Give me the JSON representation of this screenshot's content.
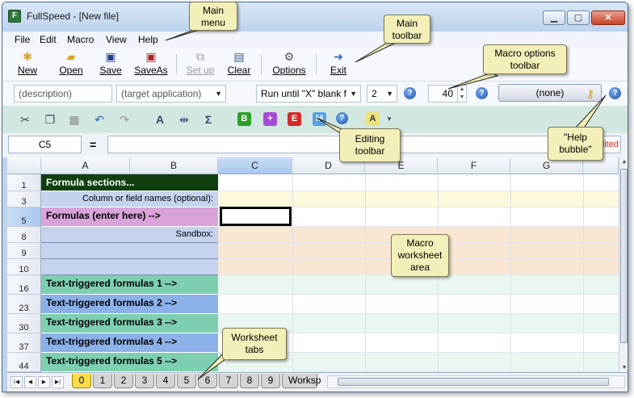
{
  "window": {
    "title": "FullSpeed - [New file]"
  },
  "menu": [
    "File",
    "Edit",
    "Macro",
    "View",
    "Help"
  ],
  "main_toolbar": [
    {
      "label": "New",
      "icon": "new-file-icon"
    },
    {
      "label": "Open",
      "icon": "open-folder-icon"
    },
    {
      "label": "Save",
      "icon": "save-disk-icon"
    },
    {
      "label": "SaveAs",
      "icon": "save-as-icon"
    },
    {
      "label": "Set up",
      "icon": "setup-icon",
      "disabled": true
    },
    {
      "label": "Clear",
      "icon": "clear-icon"
    },
    {
      "label": "Options",
      "icon": "options-icon"
    },
    {
      "label": "Exit",
      "icon": "exit-icon"
    }
  ],
  "macro_options": {
    "description_placeholder": "(description)",
    "target_app_placeholder": "(target application)",
    "run_mode": "Run until \"X\" blank f",
    "count": "2",
    "speed": "40",
    "hotkey": "(none)"
  },
  "formula_bar": {
    "cell_ref": "C5",
    "eq": "=",
    "edited_label": "dited"
  },
  "columns": [
    "A",
    "B",
    "C",
    "D",
    "E",
    "F",
    "G"
  ],
  "rows": [
    {
      "num": "1",
      "label": "Formula sections...",
      "style": "section"
    },
    {
      "num": "3",
      "label": "Column or field names  (optional):",
      "style": "names"
    },
    {
      "num": "5",
      "label": "Formulas (enter here) -->",
      "style": "formulas"
    },
    {
      "num": "8",
      "label": "Sandbox:",
      "style": "sandbox"
    },
    {
      "num": "9",
      "label": "",
      "style": "sandbox"
    },
    {
      "num": "10",
      "label": "",
      "style": "sandbox"
    },
    {
      "num": "16",
      "label": "Text-triggered formulas 1 -->",
      "style": "green"
    },
    {
      "num": "23",
      "label": "Text-triggered formulas 2 -->",
      "style": "blue"
    },
    {
      "num": "30",
      "label": "Text-triggered formulas 3 -->",
      "style": "green"
    },
    {
      "num": "37",
      "label": "Text-triggered formulas 4 -->",
      "style": "blue"
    },
    {
      "num": "44",
      "label": "Text-triggered formulas 5 -->",
      "style": "green"
    }
  ],
  "sheet_tabs": [
    "0",
    "1",
    "2",
    "3",
    "4",
    "5",
    "6",
    "7",
    "8",
    "9",
    "Worksp"
  ],
  "active_tab": "0",
  "callouts": {
    "main_menu": "Main\nmenu",
    "main_toolbar": "Main\ntoolbar",
    "macro_options": "Macro options\ntoolbar",
    "editing": "Editing\ntoolbar",
    "help_bubble": "\"Help\nbubble\"",
    "worksheet_area": "Macro\nworksheet\narea",
    "worksheet_tabs": "Worksheet\ntabs"
  },
  "colors": {
    "section_bg": "#0f3f0f",
    "names_bg": "#c5d3ee",
    "formulas_bg": "#d9a3d9",
    "sandbox_bg": "#c5d3ee",
    "green_bg": "#7dcfb0",
    "blue_bg": "#8cb0e8",
    "names_row_rest": "#fdf9dc",
    "sandbox_rest": "#f9e6d3",
    "trigger_rest": "#eaf6f2"
  }
}
